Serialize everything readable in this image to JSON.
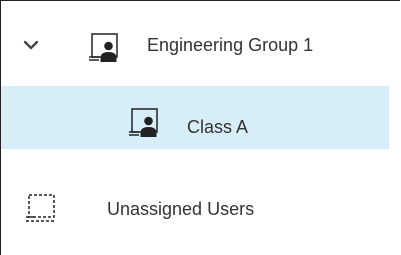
{
  "tree": {
    "items": [
      {
        "label": "Engineering Group 1",
        "icon": "classroom-icon",
        "expanded": true,
        "expander_icon": "chevron-down-icon"
      },
      {
        "label": "Class A",
        "icon": "classroom-icon",
        "selected": true
      },
      {
        "label": "Unassigned Users",
        "icon": "dashed-classroom-icon"
      }
    ],
    "colors": {
      "selected_background": "#d7edf8",
      "text": "#333333",
      "icon": "#222222"
    }
  }
}
